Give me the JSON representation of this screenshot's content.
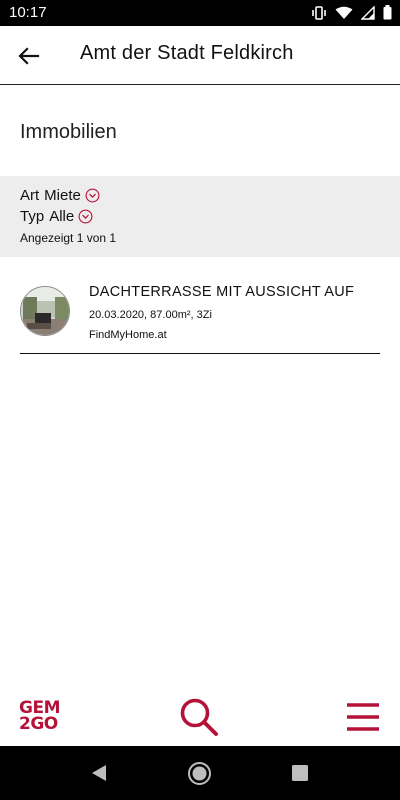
{
  "status_bar": {
    "time": "10:17",
    "icons": [
      "vibrate-icon",
      "wifi-icon",
      "signal-icon",
      "battery-icon"
    ]
  },
  "app_bar": {
    "title": "Amt der Stadt Feldkirch",
    "back_icon": "arrow-left-icon"
  },
  "section": {
    "title": "Immobilien"
  },
  "filters": {
    "art": {
      "label": "Art",
      "value": "Miete"
    },
    "typ": {
      "label": "Typ",
      "value": "Alle"
    },
    "count_text": "Angezeigt 1 von 1"
  },
  "listings": [
    {
      "title": "DACHTERRASSE MIT AUSSICHT AUF",
      "meta": "20.03.2020, 87.00m², 3Zi",
      "source": "FindMyHome.at"
    }
  ],
  "bottom_bar": {
    "logo_line1": "GEM",
    "logo_line2": "2GO",
    "search_icon": "search-icon",
    "menu_icon": "hamburger-menu-icon"
  },
  "colors": {
    "accent": "#b5123a",
    "filter_bg": "#ededed",
    "status_bg": "#000000"
  }
}
